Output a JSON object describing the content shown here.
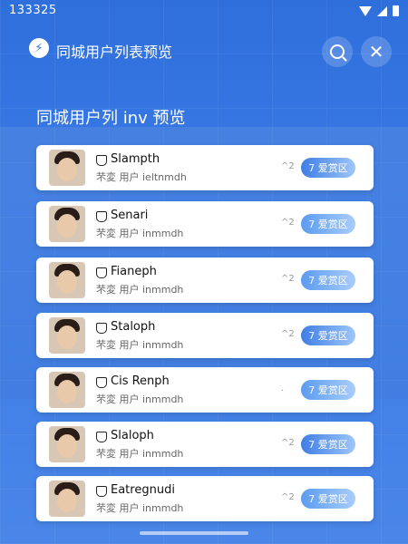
{
  "status": {
    "time": "133325"
  },
  "header": {
    "title": "同城用户列表预览",
    "logo_glyph": "⚡"
  },
  "section": {
    "title": "同城用户列 inv 预览"
  },
  "users": [
    {
      "name": "Slampth",
      "sub": "芣変 用户  ieltnmdh",
      "meta": "^2",
      "action": "7 爱赏区"
    },
    {
      "name": "Senari",
      "sub": "芣変 用户  inmmdh",
      "meta": "^2",
      "action": "7 爱赏区"
    },
    {
      "name": "Fianeph",
      "sub": "芣変 用户  inmmdh",
      "meta": "^2",
      "action": "7 爱赏区"
    },
    {
      "name": "Staloph",
      "sub": "芣変 用户  inmmdh",
      "meta": "^2",
      "action": "7 爱赏区"
    },
    {
      "name": "Cis Renph",
      "sub": "芣変 用户  inmmdh",
      "meta": ".",
      "action": "7 爱赏区"
    },
    {
      "name": "Slaloph",
      "sub": "芣変 用户  inmmdh",
      "meta": "^2",
      "action": "7 爱赏区"
    },
    {
      "name": "Eatregnudi",
      "sub": "芣変 用户  inmmdh",
      "meta": "^2",
      "action": "7 爱赏区"
    }
  ]
}
